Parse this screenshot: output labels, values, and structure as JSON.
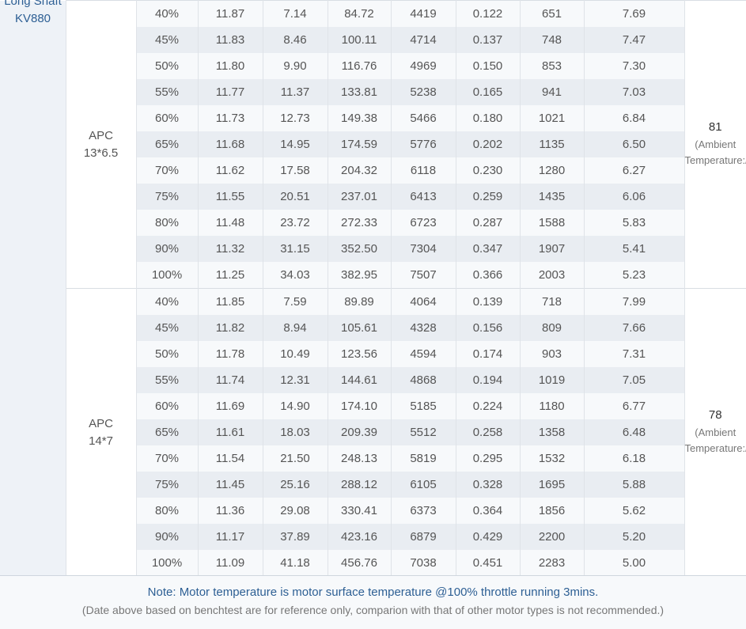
{
  "motor": {
    "line1": "Long Shaft",
    "line2": "KV880"
  },
  "groups": [
    {
      "prop_line1": "APC",
      "prop_line2": "13*6.5",
      "temp_value": "81",
      "temp_note1": "(Ambient",
      "temp_note2": "Temperature:/)",
      "rows": [
        [
          "40%",
          "11.87",
          "7.14",
          "84.72",
          "4419",
          "0.122",
          "651",
          "7.69"
        ],
        [
          "45%",
          "11.83",
          "8.46",
          "100.11",
          "4714",
          "0.137",
          "748",
          "7.47"
        ],
        [
          "50%",
          "11.80",
          "9.90",
          "116.76",
          "4969",
          "0.150",
          "853",
          "7.30"
        ],
        [
          "55%",
          "11.77",
          "11.37",
          "133.81",
          "5238",
          "0.165",
          "941",
          "7.03"
        ],
        [
          "60%",
          "11.73",
          "12.73",
          "149.38",
          "5466",
          "0.180",
          "1021",
          "6.84"
        ],
        [
          "65%",
          "11.68",
          "14.95",
          "174.59",
          "5776",
          "0.202",
          "1135",
          "6.50"
        ],
        [
          "70%",
          "11.62",
          "17.58",
          "204.32",
          "6118",
          "0.230",
          "1280",
          "6.27"
        ],
        [
          "75%",
          "11.55",
          "20.51",
          "237.01",
          "6413",
          "0.259",
          "1435",
          "6.06"
        ],
        [
          "80%",
          "11.48",
          "23.72",
          "272.33",
          "6723",
          "0.287",
          "1588",
          "5.83"
        ],
        [
          "90%",
          "11.32",
          "31.15",
          "352.50",
          "7304",
          "0.347",
          "1907",
          "5.41"
        ],
        [
          "100%",
          "11.25",
          "34.03",
          "382.95",
          "7507",
          "0.366",
          "2003",
          "5.23"
        ]
      ]
    },
    {
      "prop_line1": "APC",
      "prop_line2": "14*7",
      "temp_value": "78",
      "temp_note1": "(Ambient",
      "temp_note2": "Temperature:/)",
      "rows": [
        [
          "40%",
          "11.85",
          "7.59",
          "89.89",
          "4064",
          "0.139",
          "718",
          "7.99"
        ],
        [
          "45%",
          "11.82",
          "8.94",
          "105.61",
          "4328",
          "0.156",
          "809",
          "7.66"
        ],
        [
          "50%",
          "11.78",
          "10.49",
          "123.56",
          "4594",
          "0.174",
          "903",
          "7.31"
        ],
        [
          "55%",
          "11.74",
          "12.31",
          "144.61",
          "4868",
          "0.194",
          "1019",
          "7.05"
        ],
        [
          "60%",
          "11.69",
          "14.90",
          "174.10",
          "5185",
          "0.224",
          "1180",
          "6.77"
        ],
        [
          "65%",
          "11.61",
          "18.03",
          "209.39",
          "5512",
          "0.258",
          "1358",
          "6.48"
        ],
        [
          "70%",
          "11.54",
          "21.50",
          "248.13",
          "5819",
          "0.295",
          "1532",
          "6.18"
        ],
        [
          "75%",
          "11.45",
          "25.16",
          "288.12",
          "6105",
          "0.328",
          "1695",
          "5.88"
        ],
        [
          "80%",
          "11.36",
          "29.08",
          "330.41",
          "6373",
          "0.364",
          "1856",
          "5.62"
        ],
        [
          "90%",
          "11.17",
          "37.89",
          "423.16",
          "6879",
          "0.429",
          "2200",
          "5.20"
        ],
        [
          "100%",
          "11.09",
          "41.18",
          "456.76",
          "7038",
          "0.451",
          "2283",
          "5.00"
        ]
      ]
    }
  ],
  "note": {
    "line1": "Note: Motor temperature is motor surface temperature @100% throttle running 3mins.",
    "line2": "(Date above based on benchtest are for reference only, comparion with that of other motor types is not recommended.)"
  }
}
